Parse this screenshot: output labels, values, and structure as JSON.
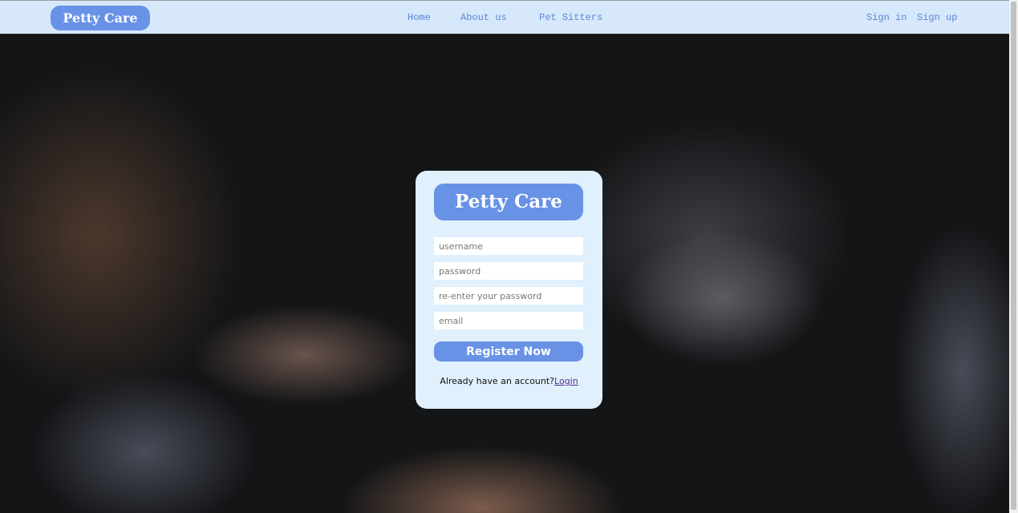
{
  "nav": {
    "logo": "Petty Care",
    "links": [
      "Home",
      "About us",
      "Pet Sitters"
    ],
    "sign_in": "Sign in",
    "sign_up": "Sign up"
  },
  "form": {
    "logo": "Petty Care",
    "username_placeholder": "username",
    "password_placeholder": "password",
    "reenter_placeholder": "re-enter your password",
    "email_placeholder": "email",
    "register_label": "Register Now",
    "have_account": "Already have an account?",
    "login_link": "Login"
  },
  "colors": {
    "accent": "#6892e6",
    "nav_bg": "#d6e8fa",
    "card_bg": "#e0f0fd"
  }
}
